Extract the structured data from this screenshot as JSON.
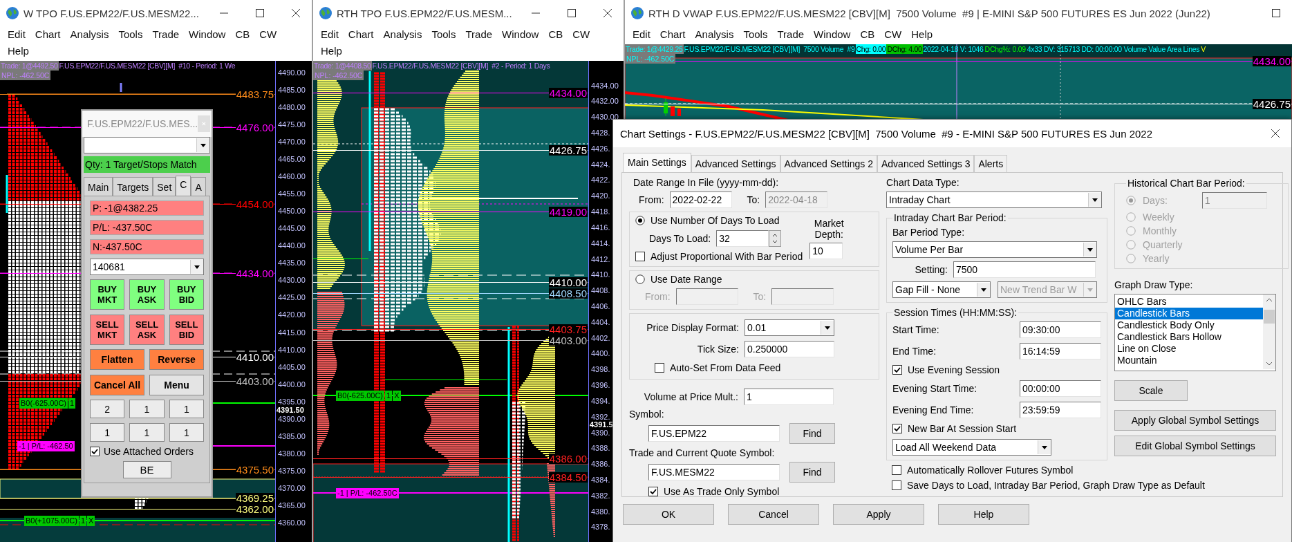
{
  "windows": [
    {
      "title": "W TPO F.US.EPM22/F.US.MESM22...",
      "menu": [
        "Edit",
        "Chart",
        "Analysis",
        "Tools",
        "Trade",
        "Window",
        "CB",
        "CW",
        "Help"
      ],
      "info": [
        {
          "kind": "trade",
          "text": "Trade: 1@4492.50"
        },
        {
          "kind": "label",
          "text": "F.US.EPM22/F.US.MESM22 [CBV][M]  #10 - Period: 1 We"
        }
      ],
      "npl": "NPL: -462.50C",
      "axis": [
        "4490.00",
        "4485.00",
        "4480.00",
        "4475.00",
        "4470.00",
        "4465.00",
        "4460.00",
        "4455.00",
        "4450.00",
        "4445.00",
        "4440.00",
        "4435.00",
        "4430.00",
        "4425.00",
        "4420.00",
        "4415.00",
        "4410.00",
        "4405.00",
        "4400.00",
        "4395.00",
        "4390.00",
        "4385.00",
        "4380.00",
        "4375.00",
        "4370.00",
        "4365.00",
        "4360.00"
      ],
      "current_price": "4391.50",
      "price_labels": [
        {
          "text": "4483.75",
          "color": "#ff8c1a"
        },
        {
          "text": "4476.00",
          "color": "#ff00ff"
        },
        {
          "text": "4454.00",
          "color": "#ff0000"
        },
        {
          "text": "4434.00",
          "color": "#ff00ff"
        },
        {
          "text": "4410.00",
          "color": "#ffffff"
        },
        {
          "text": "4403.00",
          "color": "#c0c0c0"
        },
        {
          "text": "4375.50",
          "color": "#ff8c1a"
        },
        {
          "text": "4369.25",
          "color": "#ffff80"
        },
        {
          "text": "4362.00",
          "color": "#ffff80"
        }
      ],
      "order_labels": [
        {
          "kind": "order",
          "parts": [
            "B0(-625.00C)",
            "1"
          ]
        },
        {
          "kind": "position",
          "parts": [
            "-1 | P/L: -462.50"
          ]
        },
        {
          "kind": "order",
          "parts": [
            "B0(+1075.00C)",
            "1",
            "X"
          ]
        }
      ]
    },
    {
      "title": "RTH TPO F.US.EPM22/F.US.MESM...",
      "menu": [
        "Edit",
        "Chart",
        "Analysis",
        "Tools",
        "Trade",
        "Window",
        "CB",
        "CW",
        "Help"
      ],
      "info": [
        {
          "kind": "trade",
          "text": "Trade: 1@4408.50"
        },
        {
          "kind": "label",
          "text": "F.US.EPM22/F.US.MESM22 [CBV][M]  #2 - Period: 1 Days"
        }
      ],
      "npl": "NPL: -462.50C",
      "axis": [
        "4434.00",
        "4432.00",
        "4430.00",
        "4428.",
        "4426.",
        "4424.",
        "4422.",
        "4420.",
        "4418.",
        "4416.",
        "4414.",
        "4412.",
        "4410.",
        "4408.",
        "4406.",
        "4404.",
        "4402.",
        "4400.",
        "4398.",
        "4396.",
        "4394.",
        "4392.",
        "4390.",
        "4388.",
        "4386.",
        "4384.",
        "4382.",
        "4380.",
        "4378."
      ],
      "current_price": "4391.5",
      "price_labels": [
        {
          "text": "4434.00",
          "color": "#ff00ff"
        },
        {
          "text": "4426.75",
          "color": "#ffffff"
        },
        {
          "text": "4419.00",
          "color": "#ff00ff"
        },
        {
          "text": "4410.00",
          "color": "#ffffff"
        },
        {
          "text": "4408.50",
          "color": "#a0d8ff"
        },
        {
          "text": "4403.75",
          "color": "#ff2020"
        },
        {
          "text": "4403.00",
          "color": "#c0c0c0"
        },
        {
          "text": "4386.00",
          "color": "#ff2020"
        },
        {
          "text": "4384.50",
          "color": "#ff2020"
        }
      ],
      "order_labels": [
        {
          "kind": "order",
          "parts": [
            "B0(-625.00C)",
            "1",
            "X"
          ]
        },
        {
          "kind": "position",
          "parts": [
            "-1 | P/L: -462.50C"
          ]
        }
      ]
    },
    {
      "title": "RTH D VWAP F.US.EPM22/F.US.MESM22 [CBV][M]  7500 Volume  #9 | E-MINI S&P 500 FUTURES ES Jun 2022 (Jun22)",
      "menu": [
        "Edit",
        "Chart",
        "Analysis",
        "Tools",
        "Trade",
        "Window",
        "CB",
        "CW",
        "Help"
      ],
      "info": [
        {
          "kind": "trade-quote",
          "text": "Trade: 1@4429.25"
        },
        {
          "kind": "quote",
          "text": "F.US.EPM22/F.US.MESM22 [CBV][M]  7500 Volume  #9"
        },
        {
          "kind": "chip",
          "text": "Chg: 0.00",
          "color": "#00ffff"
        },
        {
          "kind": "chip",
          "text": "DChg: 4.00",
          "color": "#00c000"
        },
        {
          "kind": "quote",
          "text": "2022-04-18 V: 1046"
        },
        {
          "kind": "gain",
          "text": "DChg%: 0.09"
        },
        {
          "kind": "quote",
          "text": "4x33 DV: 315713 DD: 00:00:00 Volume Value Area Lines"
        },
        {
          "kind": "flag",
          "text": "V"
        }
      ],
      "npl": "NPL: -462.50C",
      "price_labels": [
        {
          "text": "4434.00",
          "color": "#ff00ff"
        },
        {
          "text": "4426.75",
          "color": "#ffffff"
        }
      ]
    }
  ],
  "trade_window": {
    "title": "F.US.EPM22/F.US.MES...",
    "status": "Qty: 1 Target/Stops Match",
    "tabs": [
      {
        "label": "Main",
        "selected": false
      },
      {
        "label": "Targets",
        "selected": false
      },
      {
        "label": "Set",
        "selected": false
      },
      {
        "label": "C",
        "selected": true
      },
      {
        "label": "A",
        "selected": false
      }
    ],
    "fields": [
      "P: -1@4382.25",
      "P/L: -437.50C",
      "N:-437.50C"
    ],
    "account": "140681",
    "order_buttons": [
      {
        "kind": "buy",
        "label": "BUY MKT"
      },
      {
        "kind": "buy",
        "label": "BUY ASK"
      },
      {
        "kind": "buy",
        "label": "BUY BID"
      },
      {
        "kind": "sell",
        "label": "SELL MKT"
      },
      {
        "kind": "sell",
        "label": "SELL ASK"
      },
      {
        "kind": "sell",
        "label": "SELL BID"
      }
    ],
    "action_buttons": [
      {
        "kind": "action",
        "label": "Flatten"
      },
      {
        "kind": "action",
        "label": "Reverse"
      },
      {
        "kind": "action",
        "label": "Cancel All"
      },
      {
        "kind": "plain",
        "label": "Menu"
      }
    ],
    "qty_buttons": [
      "2",
      "1",
      "1",
      "1",
      "1",
      "1"
    ],
    "attached": {
      "label": "Use Attached Orders",
      "checked": true
    },
    "be": "BE"
  },
  "dialog": {
    "title": "Chart Settings - F.US.EPM22/F.US.MESM22 [CBV][M]  7500 Volume  #9 - E-MINI S&P 500 FUTURES ES Jun 2022",
    "tabs": [
      {
        "label": "Main Settings",
        "selected": true
      },
      {
        "label": "Advanced Settings",
        "selected": false
      },
      {
        "label": "Advanced Settings 2",
        "selected": false
      },
      {
        "label": "Advanced Settings 3",
        "selected": false
      },
      {
        "label": "Alerts",
        "selected": false
      }
    ],
    "date_range": {
      "label": "Date Range In File (yyyy-mm-dd):",
      "from_label": "From:",
      "from": "2022-02-22",
      "to_label": "To:",
      "to": "2022-04-18"
    },
    "days_group": {
      "radio": {
        "label": "Use Number Of Days To Load",
        "selected": true
      },
      "days_label": "Days To Load:",
      "days": "32",
      "adjust": {
        "label": "Adjust Proportional With Bar Period",
        "checked": false
      },
      "depth_label": "Market Depth:",
      "depth": "10"
    },
    "range_group": {
      "radio": {
        "label": "Use Date Range",
        "selected": false
      },
      "from_label": "From:",
      "to_label": "To:",
      "disabled": true
    },
    "price_group": {
      "format_label": "Price Display Format:",
      "format": "0.01",
      "tick_label": "Tick Size:",
      "tick": "0.250000",
      "autoset": {
        "label": "Auto-Set From Data Feed",
        "checked": false
      }
    },
    "vap_label": "Volume at Price Mult.:",
    "vap": "1",
    "symbols": [
      {
        "label": "Symbol:",
        "value": "F.US.EPM22",
        "button": "Find"
      },
      {
        "label": "Trade and Current Quote Symbol:",
        "value": "F.US.MESM22",
        "button": "Find"
      }
    ],
    "trade_only": {
      "label": "Use As Trade Only Symbol",
      "checked": true
    },
    "data_type_label": "Chart Data Type:",
    "data_type": "Intraday Chart",
    "bar_period": {
      "title": "Intraday Chart Bar Period:",
      "type_label": "Bar Period Type:",
      "type": "Volume Per Bar",
      "setting_label": "Setting:",
      "setting": "7500",
      "gap_fill": "Gap Fill - None",
      "trend": {
        "value": "New Trend Bar W",
        "disabled": true
      }
    },
    "session": {
      "title": "Session Times (HH:MM:SS):",
      "times": [
        {
          "label": "Start Time:",
          "value": "09:30:00"
        },
        {
          "label": "End Time:",
          "value": "16:14:59"
        }
      ],
      "evening": {
        "label": "Use Evening Session",
        "checked": true
      },
      "evening_times": [
        {
          "label": "Evening Start Time:",
          "value": "00:00:00"
        },
        {
          "label": "Evening End Time:",
          "value": "23:59:59"
        }
      ],
      "new_bar": {
        "label": "New Bar At Session Start",
        "checked": true
      },
      "weekend": "Load All Weekend Data"
    },
    "rollover": {
      "label": "Automatically Rollover Futures Symbol",
      "checked": false
    },
    "save_default": {
      "label": "Save Days to Load, Intraday Bar Period, Graph Draw Type as Default",
      "checked": false
    },
    "historical": {
      "title": "Historical Chart Bar Period:",
      "disabled": true,
      "days": "1",
      "options": [
        {
          "label": "Days:",
          "selected": true
        },
        {
          "label": "Weekly",
          "selected": false
        },
        {
          "label": "Monthly",
          "selected": false
        },
        {
          "label": "Quarterly",
          "selected": false
        },
        {
          "label": "Yearly",
          "selected": false
        }
      ]
    },
    "draw_type_label": "Graph Draw Type:",
    "draw_types": [
      {
        "label": "OHLC Bars",
        "selected": false
      },
      {
        "label": "Candlestick Bars",
        "selected": true
      },
      {
        "label": "Candlestick Body Only",
        "selected": false
      },
      {
        "label": "Candlestick Bars Hollow",
        "selected": false
      },
      {
        "label": "Line on Close",
        "selected": false
      },
      {
        "label": "Mountain",
        "selected": false
      }
    ],
    "side_buttons": [
      "Scale",
      "Apply Global Symbol Settings",
      "Edit Global Symbol Settings"
    ],
    "buttons": [
      "OK",
      "Cancel",
      "Apply",
      "Help"
    ]
  }
}
